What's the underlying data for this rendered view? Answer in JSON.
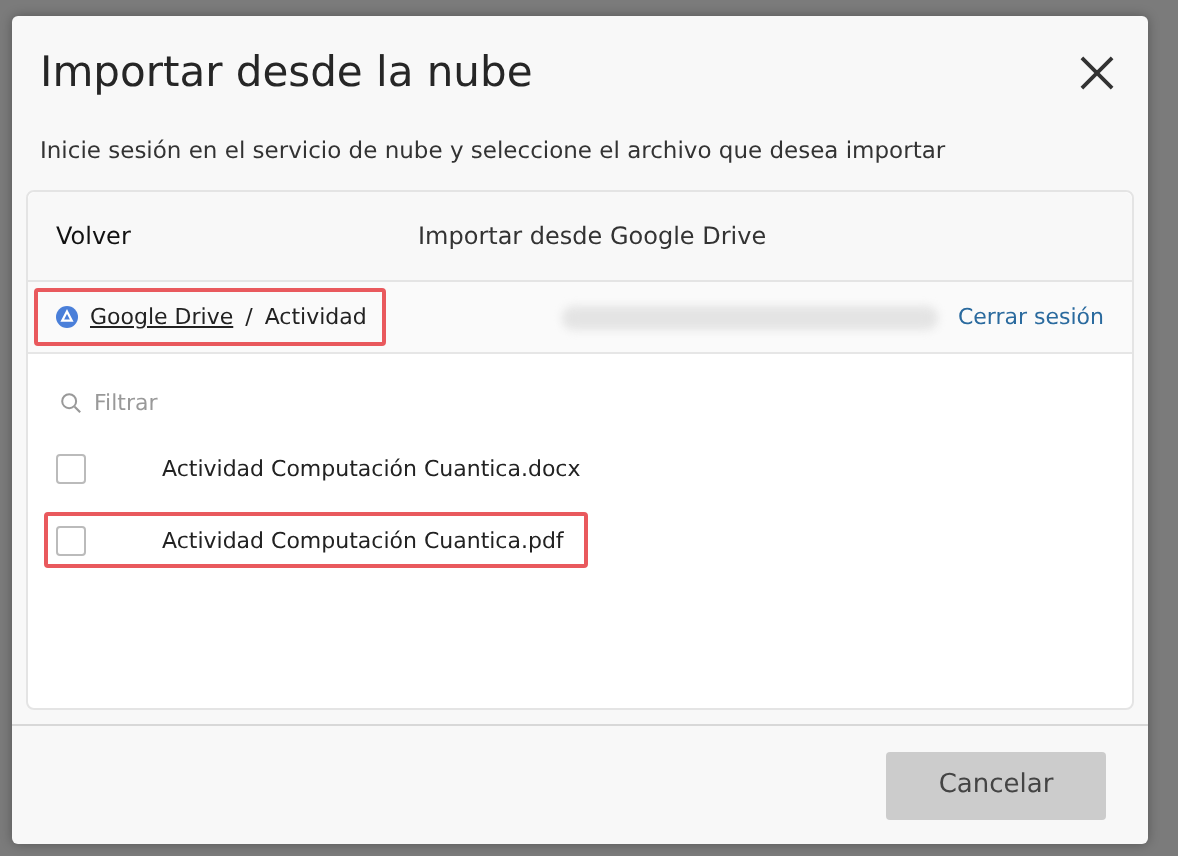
{
  "dialog": {
    "title": "Importar desde la nube",
    "subtitle": "Inicie sesión en el servicio de nube y seleccione el archivo que desea importar"
  },
  "panel": {
    "back": "Volver",
    "heading": "Importar desde Google Drive"
  },
  "breadcrumb": {
    "highlighted": true,
    "items": [
      {
        "label": "Google Drive",
        "kind": "link"
      },
      {
        "label": "Actividad",
        "kind": "current"
      }
    ],
    "separator": "/"
  },
  "account": {
    "email_redacted": true,
    "signout": "Cerrar sesión"
  },
  "filter": {
    "placeholder": "Filtrar"
  },
  "files": [
    {
      "name": "Actividad Computación Cuantica.docx",
      "checked": false,
      "highlighted": false
    },
    {
      "name": "Actividad Computación Cuantica.pdf",
      "checked": false,
      "highlighted": true
    }
  ],
  "buttons": [
    {
      "label": "Cancelar",
      "disabled": true
    }
  ]
}
